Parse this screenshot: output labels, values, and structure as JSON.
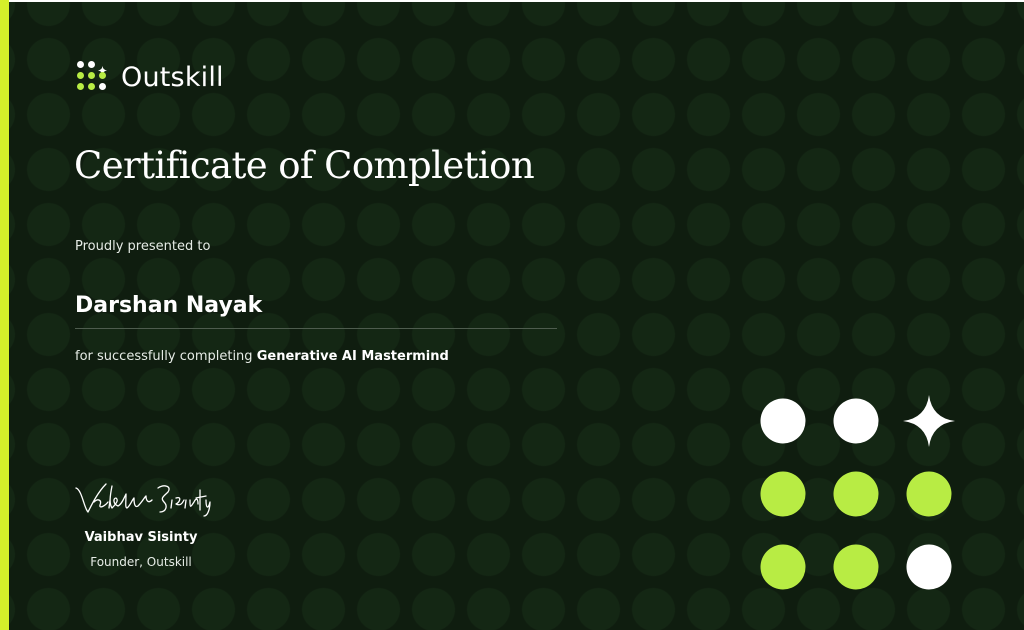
{
  "brand": {
    "name": "Outskill",
    "accent_color": "#d4ef2a",
    "lime_color": "#b8ec44",
    "background_color": "#0f1d0f"
  },
  "certificate": {
    "title": "Certificate of Completion",
    "presented_to_label": "Proudly presented to",
    "recipient_name": "Darshan Nayak",
    "completion_prefix": "for successfully completing",
    "course_name": "Generative AI Mastermind"
  },
  "signatory": {
    "signature_text": "Vaibhav Sisinty",
    "name": "Vaibhav Sisinty",
    "title": "Founder, Outskill"
  },
  "decoration": {
    "grid": [
      [
        "white-circle",
        "white-circle",
        "white-sparkle"
      ],
      [
        "lime-circle",
        "lime-circle",
        "lime-circle"
      ],
      [
        "lime-circle",
        "lime-circle",
        "white-circle"
      ]
    ]
  }
}
